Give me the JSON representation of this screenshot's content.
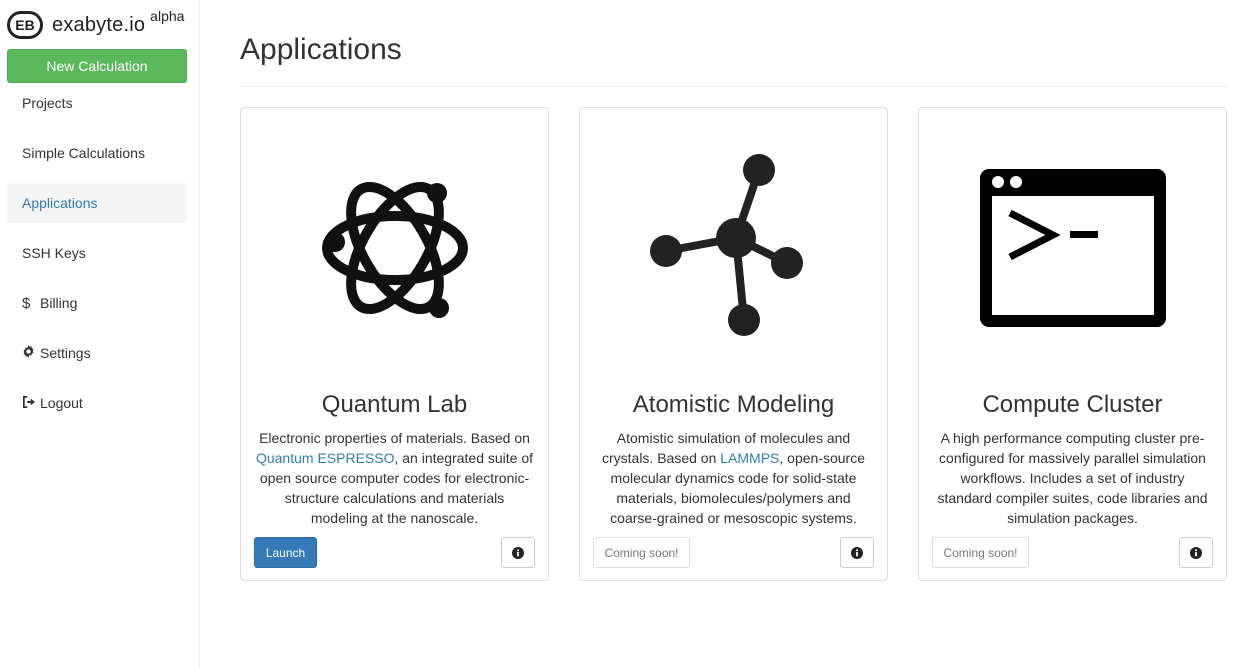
{
  "brand": {
    "name": "exabyte.io",
    "tag": "alpha",
    "logo_text": "EB"
  },
  "sidebar": {
    "new_calc_label": "New Calculation",
    "items": [
      {
        "label": "Projects",
        "icon": "",
        "active": false
      },
      {
        "label": "Simple Calculations",
        "icon": "",
        "active": false
      },
      {
        "label": "Applications",
        "icon": "",
        "active": true
      },
      {
        "label": "SSH Keys",
        "icon": "",
        "active": false
      },
      {
        "label": "Billing",
        "icon": "dollar-icon",
        "active": false
      },
      {
        "label": "Settings",
        "icon": "gear-icon",
        "active": false
      },
      {
        "label": "Logout",
        "icon": "logout-icon",
        "active": false
      }
    ]
  },
  "main": {
    "title": "Applications",
    "cards": [
      {
        "title": "Quantum Lab",
        "icon": "atom-icon",
        "desc_before": "Electronic properties of materials. Based on ",
        "desc_link": "Quantum ESPRESSO",
        "desc_after": ", an integrated suite of open source computer codes for electronic-structure calculations and materials modeling at the nanoscale.",
        "action_label": "Launch",
        "action_type": "primary"
      },
      {
        "title": "Atomistic Modeling",
        "icon": "molecule-icon",
        "desc_before": "Atomistic simulation of molecules and crystals. Based on ",
        "desc_link": "LAMMPS",
        "desc_after": ", open-source molecular dynamics code for solid-state materials, biomolecules/polymers and coarse-grained or mesoscopic systems.",
        "action_label": "Coming soon!",
        "action_type": "default"
      },
      {
        "title": "Compute Cluster",
        "icon": "terminal-icon",
        "desc_before": "A high performance computing cluster pre-configured for massively parallel simulation workflows. Includes a set of industry standard compiler suites, code libraries and simulation packages.",
        "desc_link": "",
        "desc_after": "",
        "action_label": "Coming soon!",
        "action_type": "default"
      }
    ]
  },
  "colors": {
    "primary": "#337ab7",
    "success": "#5cb85c",
    "active_bg": "#f5f5f5"
  }
}
